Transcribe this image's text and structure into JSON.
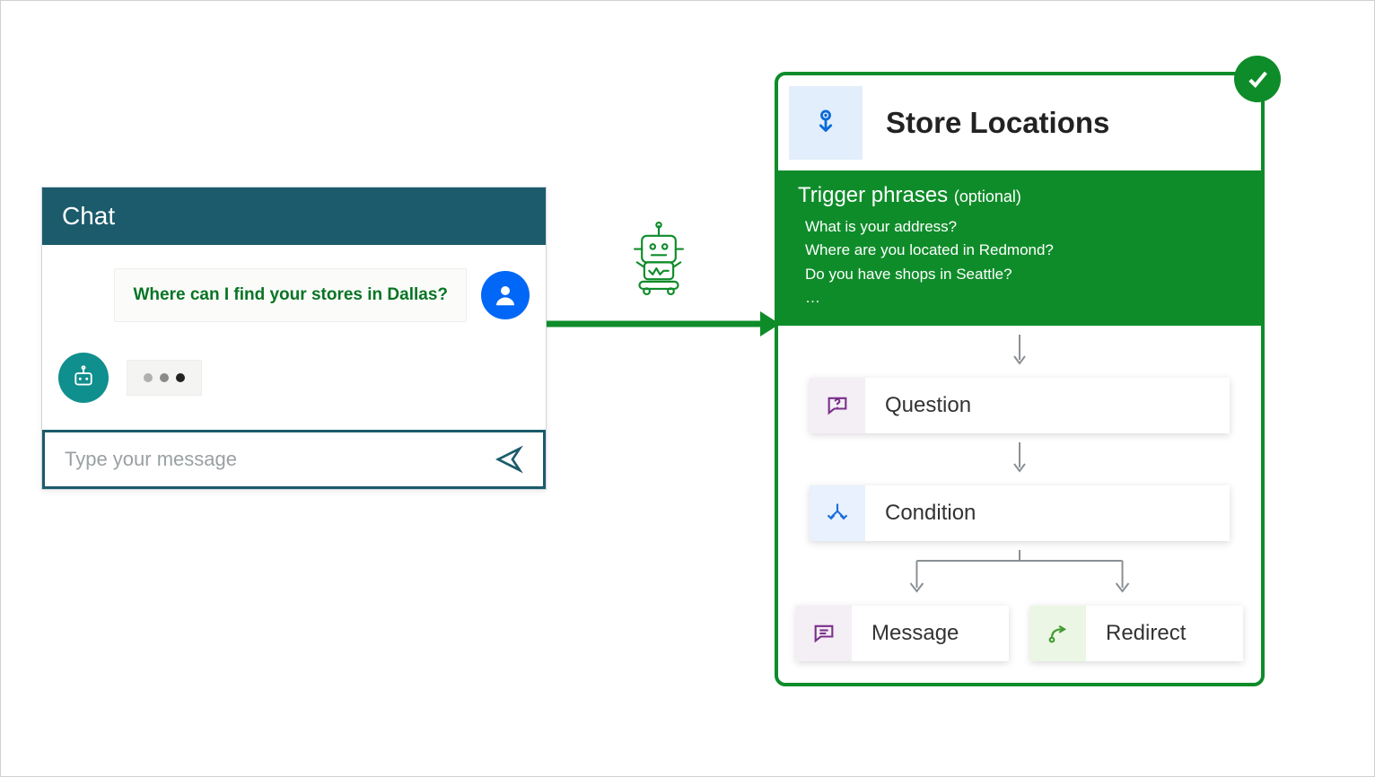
{
  "chat": {
    "title": "Chat",
    "user_message": "Where can I find your stores in Dallas?",
    "input_placeholder": "Type your message"
  },
  "topic": {
    "title": "Store Locations",
    "trigger_heading": "Trigger phrases",
    "trigger_optional_suffix": "(optional)",
    "trigger_phrases": [
      "What is your address?",
      "Where are you located in Redmond?",
      "Do you have shops in Seattle?",
      "…"
    ],
    "nodes": {
      "question": "Question",
      "condition": "Condition",
      "message": "Message",
      "redirect": "Redirect"
    }
  },
  "colors": {
    "brand_green": "#0f8c2a",
    "accent_blue": "#0067f6",
    "teal": "#1b5b6b",
    "text_green": "#087424"
  }
}
